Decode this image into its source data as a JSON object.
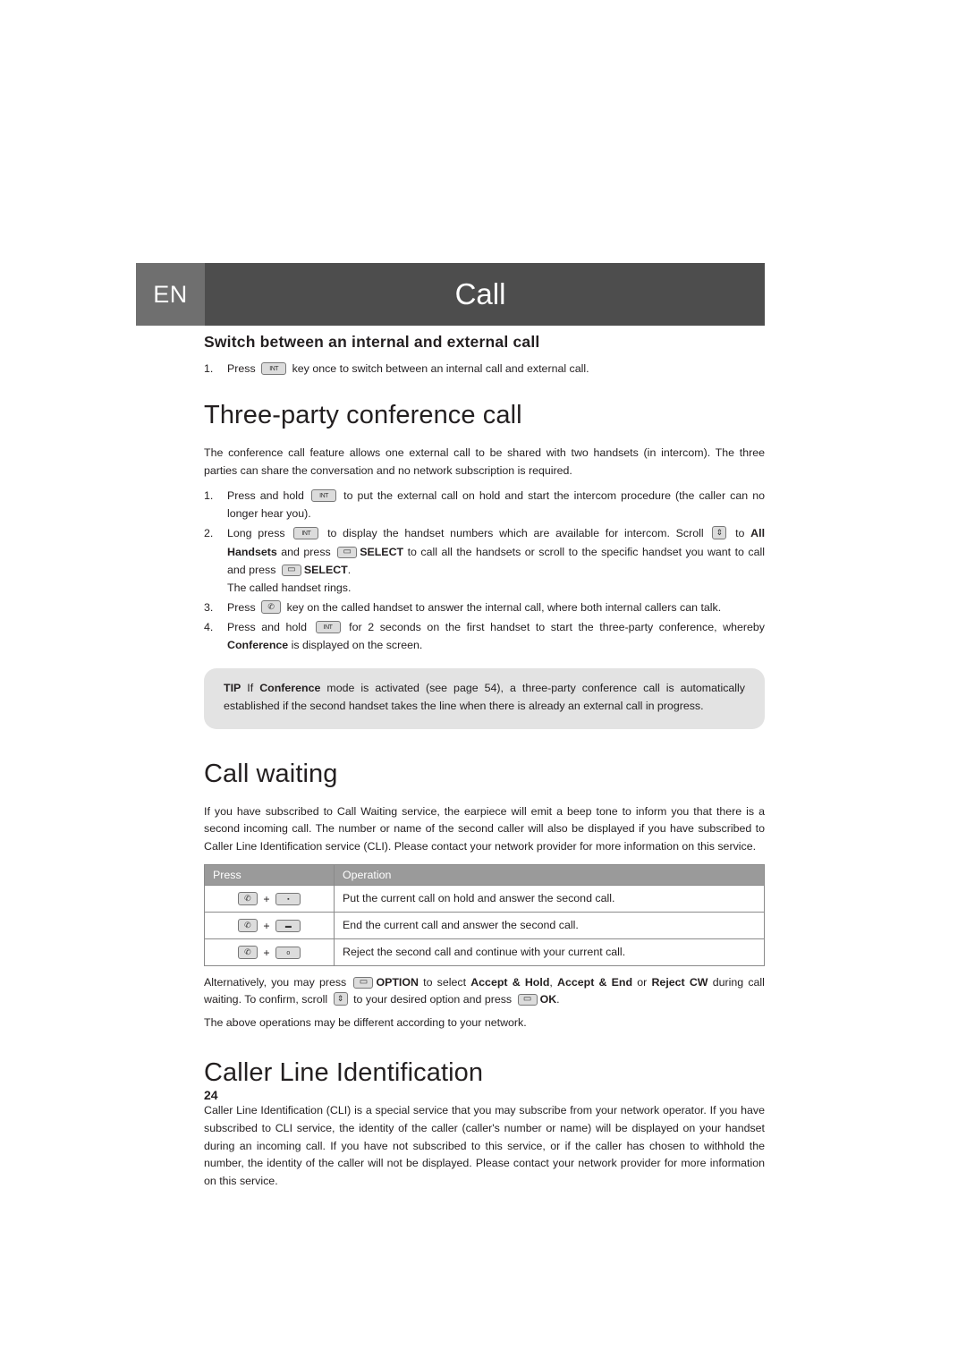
{
  "header": {
    "lang": "EN",
    "title": "Call"
  },
  "sections": {
    "switch": {
      "heading": "Switch between an internal and external call",
      "steps": [
        {
          "num": "1.",
          "pre": "Press",
          "post": "key once to switch between an internal call and external call."
        }
      ]
    },
    "conference": {
      "heading": "Three-party conference call",
      "intro": "The conference call feature allows one external call to be shared with two handsets (in intercom). The three parties can share the conversation and no network subscription is required.",
      "steps": [
        {
          "num": "1.",
          "pre": "Press and hold",
          "post": "to put the external call on hold and start the intercom procedure (the caller can no longer hear you)."
        },
        {
          "num": "2.",
          "pre": "Long press",
          "mid": "to display the handset numbers which are available for intercom. Scroll",
          "mid2": "to",
          "b1": "All Handsets",
          "mid3": "and press",
          "b2": "SELECT",
          "mid4": "to call all the handsets or scroll to the specific handset you want to call and press",
          "b3": "SELECT",
          "end": ".",
          "extra": "The called handset rings."
        },
        {
          "num": "3.",
          "pre": "Press",
          "post": "key on the called handset to answer the internal call, where both internal callers can talk."
        },
        {
          "num": "4.",
          "pre": "Press and hold",
          "post": "for 2 seconds on the first handset to start the three-party conference, whereby",
          "bold": "Conference",
          "post2": "is displayed on the screen."
        }
      ],
      "tip": {
        "label": "TIP",
        "text_a": "If",
        "bold_a": "Conference",
        "text_b": "mode is activated (see page 54), a three-party conference call is automatically established if the second handset takes the line when there is already an external call in progress."
      }
    },
    "call_waiting": {
      "heading": "Call waiting",
      "intro": "If you have subscribed to Call Waiting service, the earpiece will emit a beep tone to inform you that there is a second incoming call. The number or name of the second caller will also be displayed if you have subscribed to Caller Line Identification service (CLI). Please contact your network provider for more information on this service.",
      "table": {
        "columns": [
          "Press",
          "Operation"
        ],
        "rows": [
          {
            "keys": [
              "talk",
              "hold"
            ],
            "operation": "Put the current call on hold and answer the second call."
          },
          {
            "keys": [
              "talk",
              "end"
            ],
            "operation": "End the current call and answer the second call."
          },
          {
            "keys": [
              "talk",
              "zero"
            ],
            "operation": "Reject the second call and continue with your current call."
          }
        ]
      },
      "alt_a": "Alternatively, you may press",
      "alt_option": "OPTION",
      "alt_b": "to select",
      "alt_opt1": "Accept & Hold",
      "alt_comma": ",",
      "alt_opt2": "Accept & End",
      "alt_or": "or",
      "alt_opt3": "Reject CW",
      "alt_c": "during call waiting. To confirm, scroll",
      "alt_d": "to your desired option and press",
      "alt_ok": "OK",
      "alt_e": ".",
      "note": "The above operations may be different according to your network."
    },
    "cli": {
      "heading": "Caller Line Identification",
      "body": "Caller Line Identification (CLI) is a special service that you may subscribe from your network operator. If you have subscribed to CLI service, the identity of the caller (caller's number or name) will be displayed on your handset during an incoming call. If you have not subscribed to this service, or if the caller has chosen to withhold the number, the identity of the caller will not be displayed. Please contact your network provider for more information on this service."
    }
  },
  "page_number": "24",
  "icons": {
    "intercom_key": "INT",
    "scroll_key": "⇕",
    "softkey": "▭",
    "talk_key": "✆",
    "hold_key": "▪",
    "end_key": "▬",
    "zero_key": "o"
  },
  "colors": {
    "header_lang_bg": "#6f6f6f",
    "header_title_bg": "#4d4d4d",
    "tip_bg": "#e3e3e3",
    "table_header_bg": "#9a9a9a",
    "text": "#231f20"
  }
}
